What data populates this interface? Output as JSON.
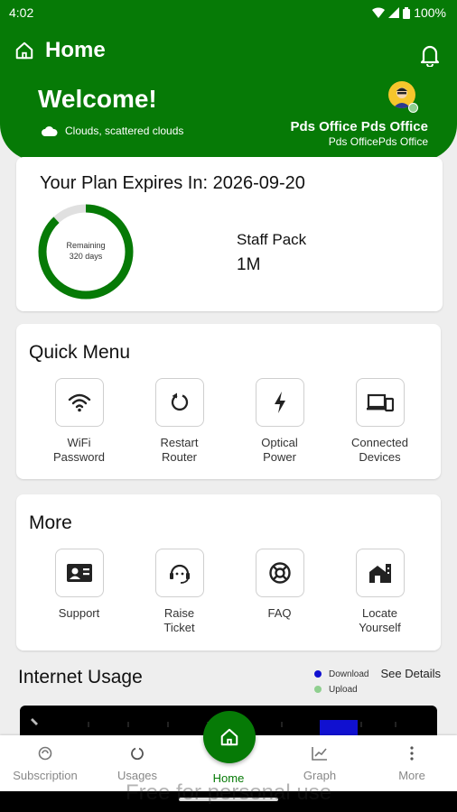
{
  "status_bar": {
    "time": "4:02",
    "battery": "100%"
  },
  "header": {
    "title": "Home",
    "welcome": "Welcome!",
    "weather": "Clouds, scattered clouds",
    "user_name": "Pds Office Pds Office",
    "user_subtitle": "Pds OfficePds Office"
  },
  "plan": {
    "title": "Your Plan Expires In: 2026-09-20",
    "remaining_label": "Remaining",
    "remaining_days": "320 days",
    "remaining_fraction": 0.88,
    "pack_name": "Staff Pack",
    "pack_speed": "1M"
  },
  "quick_menu": {
    "title": "Quick Menu",
    "items": [
      {
        "line1": "WiFi",
        "line2": "Password",
        "icon": "wifi-icon"
      },
      {
        "line1": "Restart",
        "line2": "Router",
        "icon": "restart-icon"
      },
      {
        "line1": "Optical",
        "line2": "Power",
        "icon": "bolt-icon"
      },
      {
        "line1": "Connected",
        "line2": "Devices",
        "icon": "devices-icon"
      }
    ]
  },
  "more": {
    "title": "More",
    "items": [
      {
        "line1": "Support",
        "line2": "",
        "icon": "contact-card-icon"
      },
      {
        "line1": "Raise",
        "line2": "Ticket",
        "icon": "support-agent-icon"
      },
      {
        "line1": "FAQ",
        "line2": "",
        "icon": "lifebuoy-icon"
      },
      {
        "line1": "Locate",
        "line2": "Yourself",
        "icon": "home-location-icon"
      }
    ]
  },
  "usage": {
    "title": "Internet Usage",
    "legend_download": "Download",
    "legend_upload": "Upload",
    "see_details": "See Details"
  },
  "nav": {
    "subscription": "Subscription",
    "usages": "Usages",
    "home": "Home",
    "graph": "Graph",
    "more": "More"
  },
  "watermark": "Free for personal use",
  "colors": {
    "primary": "#067a06",
    "download": "#1010d0",
    "upload": "#8fcf8f",
    "ring_track": "#e0e0e0"
  }
}
